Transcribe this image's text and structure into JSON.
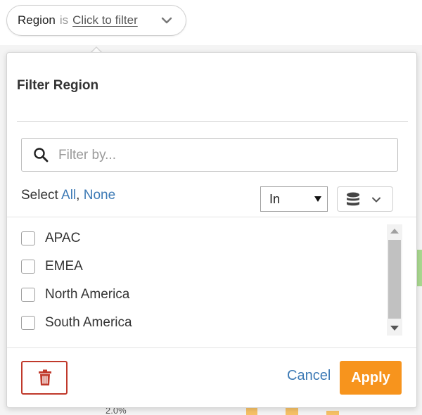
{
  "filter_pill": {
    "field": "Region",
    "operator": "is",
    "value": "Click to filter"
  },
  "popup": {
    "title": "Filter Region",
    "search": {
      "placeholder": "Filter by...",
      "value": ""
    },
    "select": {
      "prefix": "Select",
      "all": "All",
      "separator": ",",
      "none": "None"
    },
    "mode_select": {
      "value": "In"
    },
    "source_icon": "database-icon",
    "items": [
      {
        "label": "APAC",
        "checked": false
      },
      {
        "label": "EMEA",
        "checked": false
      },
      {
        "label": "North America",
        "checked": false
      },
      {
        "label": "South America",
        "checked": false
      }
    ],
    "footer": {
      "delete_icon": "trash-icon",
      "cancel_label": "Cancel",
      "apply_label": "Apply"
    }
  },
  "background": {
    "axis_fragment": "2.0%"
  },
  "colors": {
    "accent": "#f7941d",
    "link": "#3d7ab5",
    "danger": "#c0392b"
  }
}
